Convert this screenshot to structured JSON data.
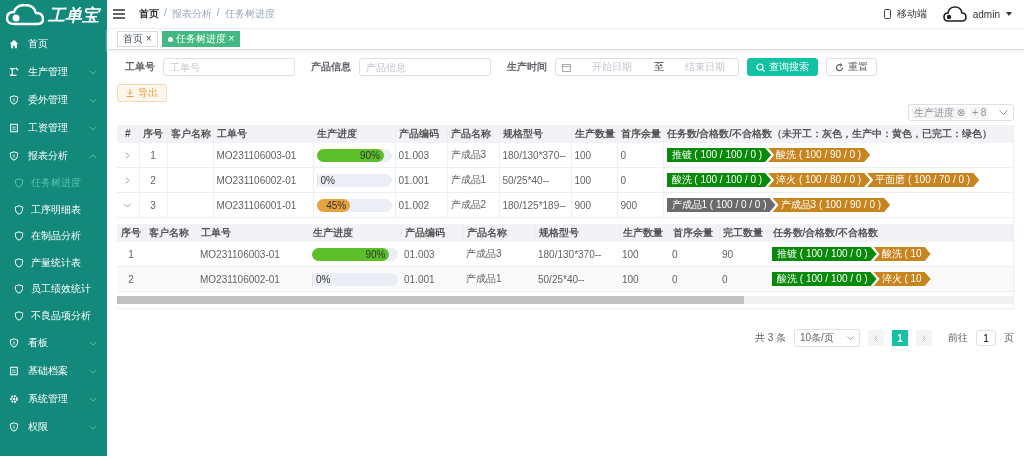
{
  "logo": {
    "text": "工单宝"
  },
  "sidebar": {
    "items": [
      {
        "label": "首页",
        "selected": false
      },
      {
        "label": "生产管理",
        "selected": false,
        "expanded": false
      },
      {
        "label": "委外管理",
        "selected": false,
        "expanded": false
      },
      {
        "label": "工资管理",
        "selected": false,
        "expanded": false
      },
      {
        "label": "报表分析",
        "selected": false,
        "expanded": true,
        "children": [
          {
            "label": "任务树进度",
            "selected": true
          },
          {
            "label": "工序明细表",
            "selected": false
          },
          {
            "label": "在制品分析",
            "selected": false
          },
          {
            "label": "产量统计表",
            "selected": false
          },
          {
            "label": "员工绩效统计",
            "selected": false
          },
          {
            "label": "不良品项分析",
            "selected": false
          }
        ]
      },
      {
        "label": "看板",
        "selected": false,
        "expanded": false
      },
      {
        "label": "基础档案",
        "selected": false,
        "expanded": false
      },
      {
        "label": "系统管理",
        "selected": false,
        "expanded": false
      },
      {
        "label": "权限",
        "selected": false,
        "expanded": false
      }
    ]
  },
  "header": {
    "breadcrumbs": [
      "首页",
      "报表分析",
      "任务树进度"
    ],
    "breadcrumb_separators": [
      "/",
      "/"
    ],
    "mobile": "移动端",
    "user": "admin"
  },
  "tabs": [
    {
      "label": "首页",
      "close": "×",
      "selected": false
    },
    {
      "label": "任务树进度",
      "close": "×",
      "selected": true
    }
  ],
  "filters": {
    "fields": [
      {
        "label": "工单号",
        "placeholder": "工单号"
      },
      {
        "label": "产品信息",
        "placeholder": "产品信息"
      }
    ],
    "date": {
      "label": "生产时间",
      "start_placeholder": "开始日期",
      "separator": "至",
      "end_placeholder": "结束日期"
    },
    "search_button": "查询搜索",
    "reset_button": "重置"
  },
  "export_button": "导出",
  "column_picker": {
    "tag": "生产进度",
    "tag_close": "⊗",
    "more": "+ 8"
  },
  "table": {
    "columns": [
      "#",
      "序号",
      "客户名称",
      "工单号",
      "生产进度",
      "产品编码",
      "产品名称",
      "规格型号",
      "生产数量",
      "首序余量",
      "任务数/合格数/不合格数（未开工：灰色，生产中：黄色，已完工：绿色）"
    ],
    "rows": [
      {
        "expanded": false,
        "no": "1",
        "customer": "",
        "order": "MO231106003-01",
        "progress": {
          "level": 0.9,
          "label": "90%",
          "color": "#5cbf2a"
        },
        "code": "01.003",
        "product": "产成品3",
        "spec": "180/130*370--",
        "qty": "100",
        "remain": "0",
        "tasks": [
          {
            "text": "推镀 ( 100 / 100 / 0 )",
            "color": "#0a8a0a"
          },
          {
            "text": "酸洗 ( 100 / 90 / 0 )",
            "color": "#c8841e"
          }
        ]
      },
      {
        "expanded": false,
        "no": "2",
        "customer": "",
        "order": "MO231106002-01",
        "progress": {
          "level": 0,
          "label": "0%"
        },
        "code": "01.001",
        "product": "产成品1",
        "spec": "50/25*40--",
        "qty": "100",
        "remain": "0",
        "tasks": [
          {
            "text": "酸洗 ( 100 / 100 / 0 )",
            "color": "#0a8a0a"
          },
          {
            "text": "淬火 ( 100 / 80 / 0 )",
            "color": "#c8841e"
          },
          {
            "text": "平面磨 ( 100 / 70 / 0 )",
            "color": "#c8841e"
          }
        ]
      },
      {
        "expanded": true,
        "no": "3",
        "customer": "",
        "order": "MO231106001-01",
        "progress": {
          "level": 0.45,
          "label": "45%",
          "color": "#e6a23c"
        },
        "code": "01.002",
        "product": "产成品2",
        "spec": "180/125*189--",
        "qty": "900",
        "remain": "900",
        "tasks": [
          {
            "text": "产成品1 ( 100 / 0 / 0 )",
            "color": "#6b6b6b"
          },
          {
            "text": "产成品3 ( 100 / 90 / 0 )",
            "color": "#c8841e"
          }
        ],
        "sub_table": {
          "columns": [
            "序号",
            "客户名称",
            "工单号",
            "生产进度",
            "产品编码",
            "产品名称",
            "规格型号",
            "生产数量",
            "首序余量",
            "完工数量",
            "任务数/合格数/不合格数"
          ],
          "rows": [
            {
              "no": "1",
              "customer": "",
              "order": "MO231106003-01",
              "progress": {
                "level": 0.9,
                "label": "90%",
                "color": "#5cbf2a"
              },
              "code": "01.003",
              "product": "产成品3",
              "spec": "180/130*370--",
              "qty": "100",
              "remain": "0",
              "done": "90",
              "tasks": [
                {
                  "text": "推镀 ( 100 / 100 / 0 )",
                  "color": "#0a8a0a"
                },
                {
                  "text": "酸洗 ( 10",
                  "color": "#c8841e"
                }
              ]
            },
            {
              "no": "2",
              "customer": "",
              "order": "MO231106002-01",
              "progress": {
                "level": 0,
                "label": "0%"
              },
              "code": "01.001",
              "product": "产成品1",
              "spec": "50/25*40--",
              "qty": "100",
              "remain": "0",
              "done": "0",
              "tasks": [
                {
                  "text": "酸洗 ( 100 / 100 / 0 )",
                  "color": "#0a8a0a"
                },
                {
                  "text": "淬火 ( 10",
                  "color": "#c8841e"
                }
              ]
            }
          ]
        }
      }
    ]
  },
  "pagination": {
    "total": "共 3 条",
    "page_size": "10条/页",
    "pages": [
      {
        "label": "1",
        "selected": true
      }
    ],
    "goto_label": "前往",
    "goto_value": "1",
    "goto_suffix": "页"
  }
}
